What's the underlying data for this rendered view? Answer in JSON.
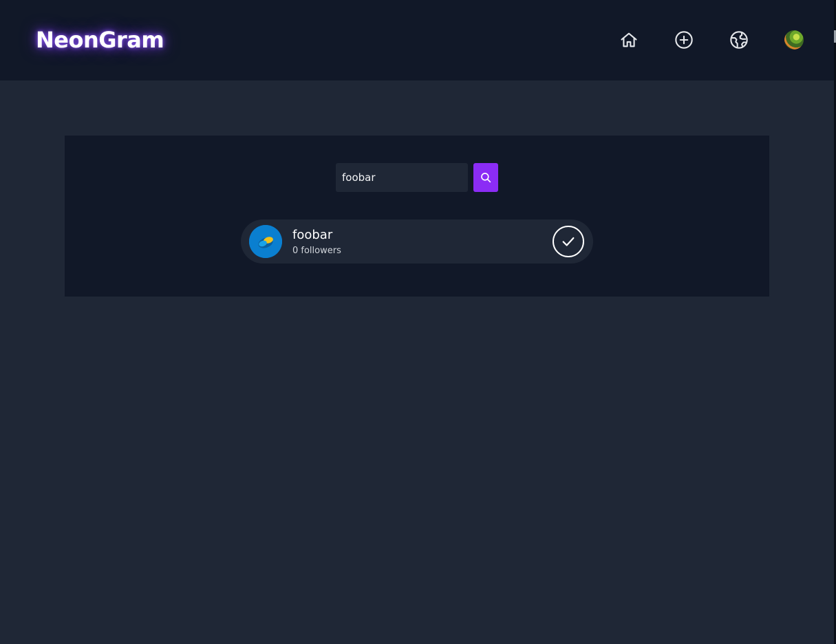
{
  "app": {
    "title": "NeonGram",
    "accent_color": "#8b2cf5",
    "background_color": "#1f2736",
    "surface_color": "#111828"
  },
  "nav": {
    "items": [
      {
        "icon": "home-icon"
      },
      {
        "icon": "plus-circle-icon"
      },
      {
        "icon": "globe-icon"
      },
      {
        "icon": "user-avatar"
      }
    ]
  },
  "search": {
    "value": "foobar",
    "button_icon": "search-icon"
  },
  "results": [
    {
      "username": "foobar",
      "followers": "0 followers",
      "avatar": "user-avatar",
      "action_icon": "check-icon"
    }
  ]
}
